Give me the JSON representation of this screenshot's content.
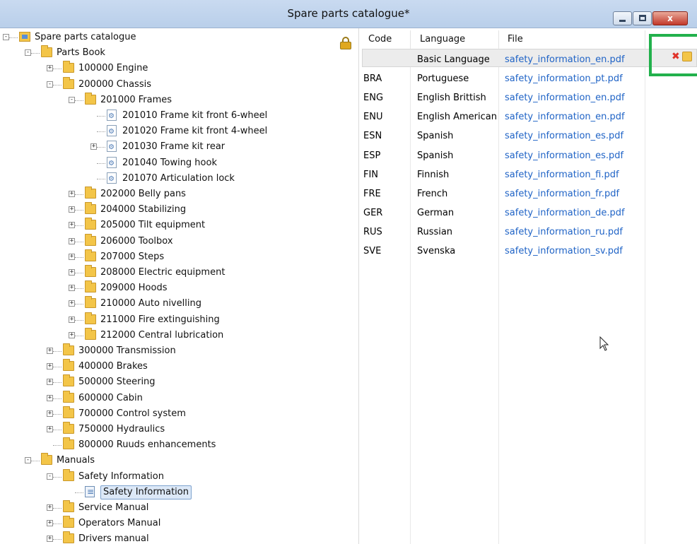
{
  "window": {
    "title": "Spare parts catalogue*",
    "minimize_glyph": "",
    "close_glyph": "x"
  },
  "tree": {
    "root": "Spare parts catalogue",
    "items": [
      {
        "label": "Parts Book"
      },
      {
        "label": "100000 Engine"
      },
      {
        "label": "200000 Chassis"
      },
      {
        "label": "201000 Frames"
      },
      {
        "label": "201010 Frame kit front 6-wheel"
      },
      {
        "label": "201020 Frame kit front 4-wheel"
      },
      {
        "label": "201030 Frame kit rear"
      },
      {
        "label": "201040 Towing hook"
      },
      {
        "label": "201070 Articulation lock"
      },
      {
        "label": "202000 Belly pans"
      },
      {
        "label": "204000 Stabilizing"
      },
      {
        "label": "205000 Tilt equipment"
      },
      {
        "label": "206000 Toolbox"
      },
      {
        "label": "207000 Steps"
      },
      {
        "label": "208000 Electric equipment"
      },
      {
        "label": "209000 Hoods"
      },
      {
        "label": "210000 Auto nivelling"
      },
      {
        "label": "211000 Fire extinguishing"
      },
      {
        "label": "212000 Central lubrication"
      },
      {
        "label": "300000 Transmission"
      },
      {
        "label": "400000 Brakes"
      },
      {
        "label": "500000 Steering"
      },
      {
        "label": "600000 Cabin"
      },
      {
        "label": "700000 Control system"
      },
      {
        "label": "750000 Hydraulics"
      },
      {
        "label": "800000 Ruuds enhancements"
      },
      {
        "label": "Manuals"
      },
      {
        "label": "Safety Information"
      },
      {
        "label": "Safety Information"
      },
      {
        "label": "Service Manual"
      },
      {
        "label": "Operators Manual"
      },
      {
        "label": "Drivers manual"
      }
    ]
  },
  "table": {
    "headers": {
      "code": "Code",
      "language": "Language",
      "file": "File"
    },
    "rows": [
      {
        "code": "",
        "language": "Basic Language",
        "file": "safety_information_en.pdf"
      },
      {
        "code": "BRA",
        "language": "Portuguese",
        "file": "safety_information_pt.pdf"
      },
      {
        "code": "ENG",
        "language": "English Brittish",
        "file": "safety_information_en.pdf"
      },
      {
        "code": "ENU",
        "language": "English American",
        "file": "safety_information_en.pdf"
      },
      {
        "code": "ESN",
        "language": "Spanish",
        "file": "safety_information_es.pdf"
      },
      {
        "code": "ESP",
        "language": "Spanish",
        "file": "safety_information_es.pdf"
      },
      {
        "code": "FIN",
        "language": "Finnish",
        "file": "safety_information_fi.pdf"
      },
      {
        "code": "FRE",
        "language": "French",
        "file": "safety_information_fr.pdf"
      },
      {
        "code": "GER",
        "language": "German",
        "file": "safety_information_de.pdf"
      },
      {
        "code": "RUS",
        "language": "Russian",
        "file": "safety_information_ru.pdf"
      },
      {
        "code": "SVE",
        "language": "Svenska",
        "file": "safety_information_sv.pdf"
      }
    ],
    "row_actions": {
      "delete_glyph": "✖"
    }
  },
  "colors": {
    "link": "#1f63c6",
    "highlight_frame": "#22b14c",
    "folder": "#f3c548",
    "delete": "#e0332a"
  }
}
